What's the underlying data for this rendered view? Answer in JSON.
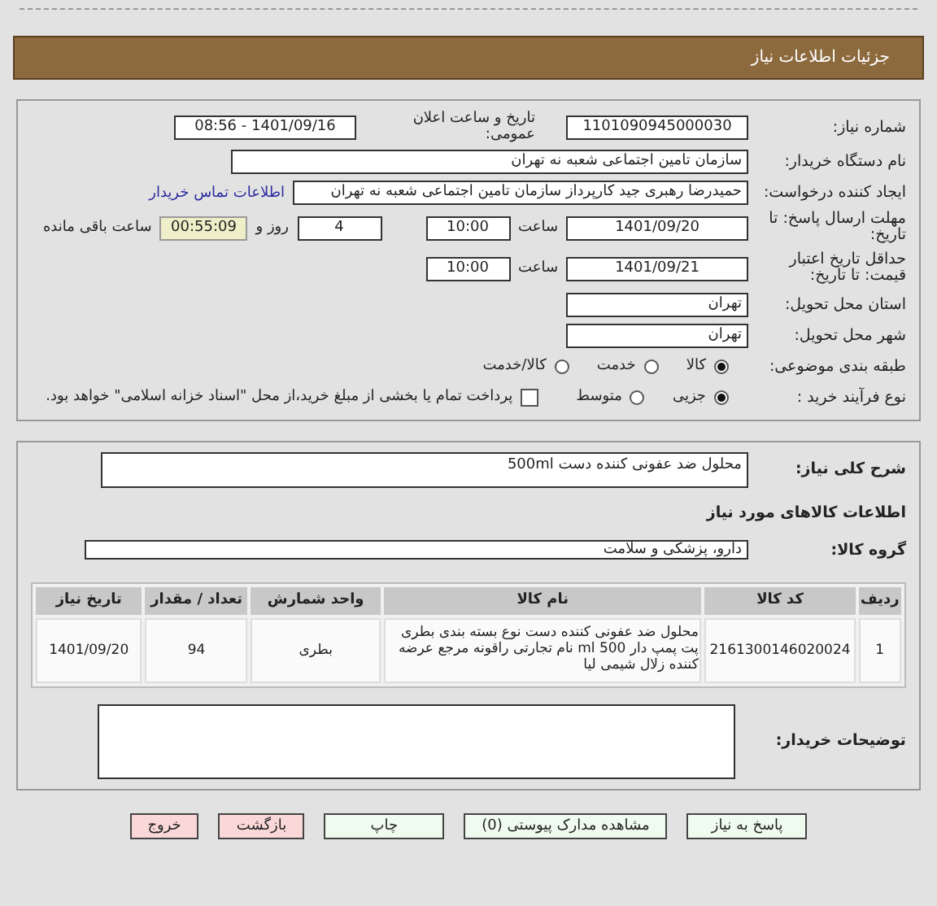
{
  "header": {
    "title": "جزئیات اطلاعات نیاز"
  },
  "need": {
    "number_label": "شماره نیاز:",
    "number": "1101090945000030",
    "announce_label": "تاریخ و ساعت اعلان عمومی:",
    "announce": "1401/09/16 - 08:56",
    "buyer_label": "نام دستگاه خریدار:",
    "buyer": "سازمان تامین اجتماعی شعبه نه تهران",
    "requester_label": "ایجاد کننده درخواست:",
    "requester": "حمیدرضا رهبری جید کارپرداز سازمان تامین اجتماعی شعبه نه تهران",
    "contact_link": "اطلاعات تماس خریدار",
    "deadline_label": "مهلت ارسال پاسخ: تا تاریخ:",
    "deadline_date": "1401/09/20",
    "deadline_time_label": "ساعت",
    "deadline_time": "10:00",
    "days": "4",
    "days_suffix": "روز و",
    "remaining": "00:55:09",
    "remaining_suffix": "ساعت باقی مانده",
    "validity_label": "حداقل تاریخ اعتبار قیمت: تا تاریخ:",
    "validity_date": "1401/09/21",
    "validity_time_label": "ساعت",
    "validity_time": "10:00",
    "province_label": "استان محل تحویل:",
    "province": "تهران",
    "city_label": "شهر محل تحویل:",
    "city": "تهران",
    "category_label": "طبقه بندی موضوعی:",
    "category_options": [
      {
        "label": "کالا",
        "selected": true
      },
      {
        "label": "خدمت",
        "selected": false
      },
      {
        "label": "کالا/خدمت",
        "selected": false
      }
    ],
    "process_label": "نوع فرآیند خرید :",
    "process_options": [
      {
        "label": "جزیی",
        "selected": true
      },
      {
        "label": "متوسط",
        "selected": false
      }
    ],
    "payment": {
      "checked": false,
      "label": "پرداخت تمام یا بخشی از مبلغ خرید،از محل \"اسناد خزانه اسلامی\" خواهد بود."
    }
  },
  "goods": {
    "description_label": "شرح کلی نیاز:",
    "description": "محلول ضد عفونی کننده دست 500ml",
    "items_title": "اطلاعات کالاهای مورد نیاز",
    "group_label": "گروه کالا:",
    "group": "دارو، پزشکی و سلامت",
    "table": {
      "columns": [
        "ردیف",
        "کد کالا",
        "نام کالا",
        "واحد شمارش",
        "تعداد / مقدار",
        "تاریخ نیاز"
      ],
      "rows": [
        [
          "1",
          "2161300146020024",
          "محلول ضد عفونی کننده دست نوع بسته بندی بطری پت پمپ دار 500 ml نام تجارتی راقونه مرجع عرضه کننده زلال شیمی لیا",
          "بطری",
          "94",
          "1401/09/20"
        ]
      ]
    },
    "notes_label": "توضیحات خریدار:"
  },
  "buttons": [
    {
      "label": "پاسخ به نیاز",
      "kind": "green"
    },
    {
      "label": "مشاهده مدارک پیوستی (0)",
      "kind": "green"
    },
    {
      "label": "چاپ",
      "kind": "green"
    },
    {
      "label": "بازگشت",
      "kind": "red"
    },
    {
      "label": "خروج",
      "kind": "red"
    }
  ]
}
